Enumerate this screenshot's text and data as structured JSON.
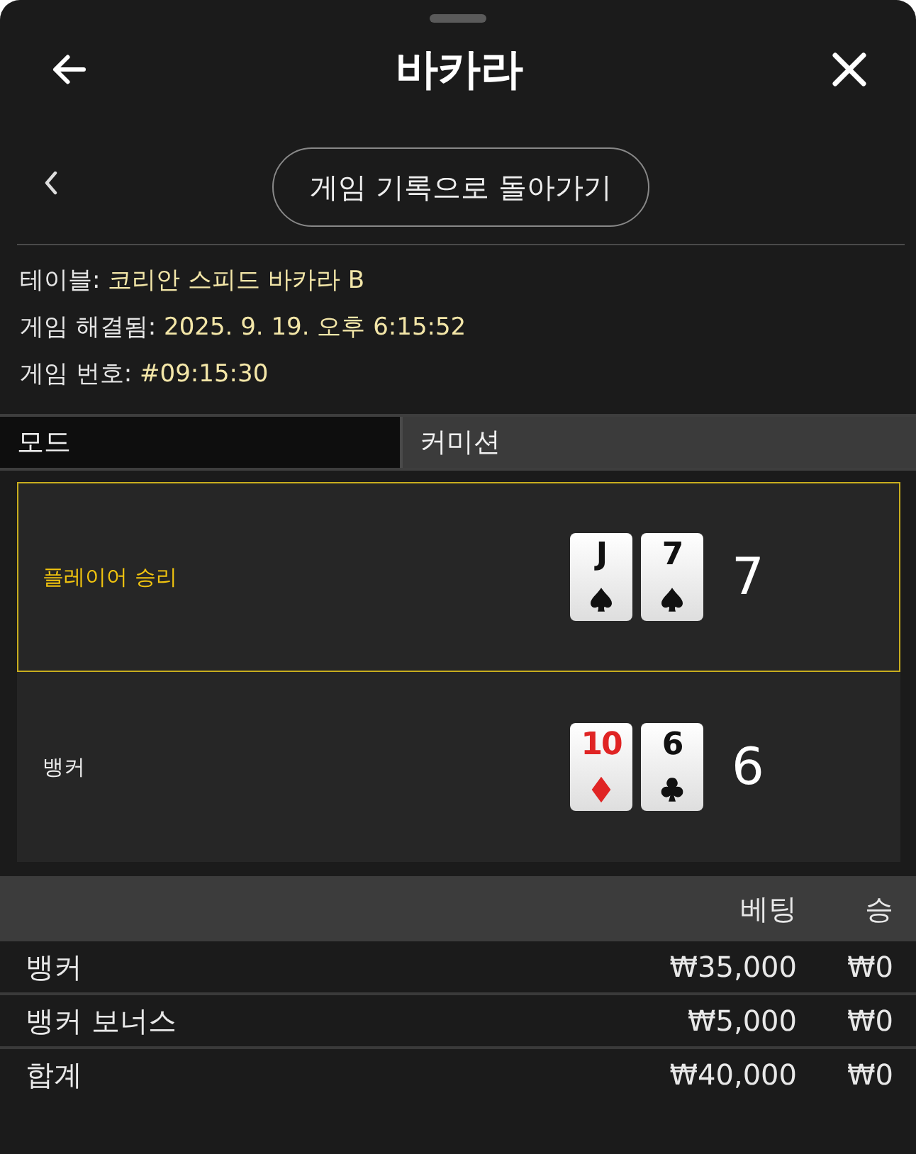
{
  "header": {
    "title": "바카라"
  },
  "back_link": {
    "label": "게임 기록으로 돌아가기"
  },
  "info": [
    {
      "label": "테이블:",
      "value": "코리안 스피드 바카라 B"
    },
    {
      "label": "게임 해결됨:",
      "value": "2025. 9. 19. 오후 6:15:52"
    },
    {
      "label": "게임 번호:",
      "value": "#09:15:30"
    }
  ],
  "tabs": [
    {
      "label": "모드",
      "selected": true
    },
    {
      "label": "커미션",
      "selected": false
    }
  ],
  "hands": [
    {
      "label": "플레이어 승리",
      "winner": true,
      "cards": [
        {
          "rank": "J",
          "kind": "spades"
        },
        {
          "rank": "7",
          "kind": "spades"
        }
      ],
      "score": "7"
    },
    {
      "label": "뱅커",
      "winner": false,
      "cards": [
        {
          "rank": "10",
          "kind": "diamonds"
        },
        {
          "rank": "6",
          "kind": "clubs"
        }
      ],
      "score": "6"
    }
  ],
  "bets": {
    "columns": [
      "베팅",
      "승"
    ],
    "rows": [
      {
        "name": "뱅커",
        "bet": "₩35,000",
        "win": "₩0"
      },
      {
        "name": "뱅커 보너스",
        "bet": "₩5,000",
        "win": "₩0"
      },
      {
        "name": "합계",
        "bet": "₩40,000",
        "win": "₩0"
      }
    ]
  }
}
